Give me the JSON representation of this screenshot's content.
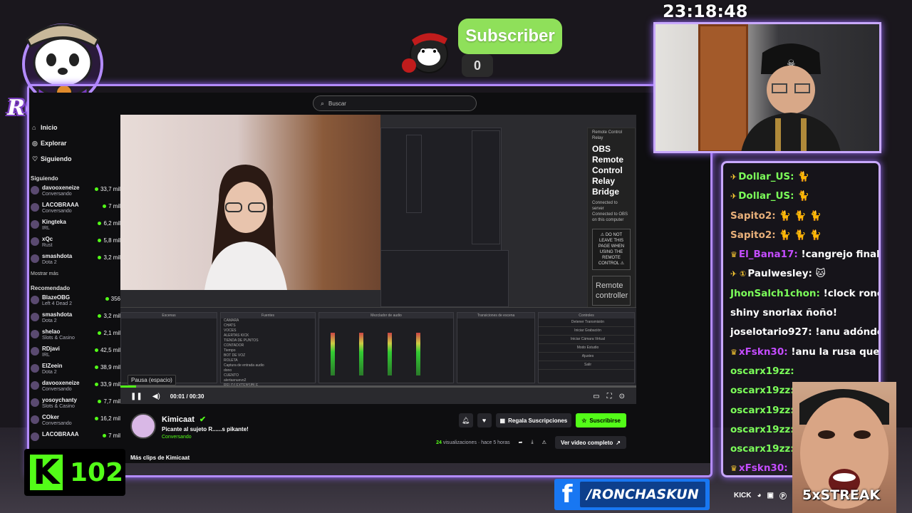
{
  "overlay": {
    "clock": "23:18:48",
    "subscriber_label": "Subscriber",
    "subscriber_count": "0",
    "logo_text": "RONCHAS",
    "kick_count": "102",
    "facebook_handle": "/RONCHASKUN",
    "social_icons": [
      "kick-icon",
      "discord-icon",
      "twitch-icon",
      "pinterest-icon"
    ],
    "social_kick_label": "KICK",
    "streak": "5xSTREAK",
    "accent_color": "#b48cff",
    "kick_green": "#53fc18"
  },
  "browser": {
    "search_placeholder": "Buscar",
    "nav": [
      {
        "label": "Inicio",
        "icon": "home-icon"
      },
      {
        "label": "Explorar",
        "icon": "compass-icon"
      },
      {
        "label": "Siguiendo",
        "icon": "heart-icon"
      }
    ],
    "following_title": "Siguiendo",
    "following": [
      {
        "name": "davooxeneize",
        "category": "Conversando",
        "viewers": "33,7 mil"
      },
      {
        "name": "LACOBRAAA",
        "category": "Conversando",
        "viewers": "7 mil"
      },
      {
        "name": "Kingteka",
        "category": "IRL",
        "viewers": "6,2 mil"
      },
      {
        "name": "xQc",
        "category": "Rust",
        "viewers": "5,8 mil"
      },
      {
        "name": "smashdota",
        "category": "Dota 2",
        "viewers": "3,2 mil"
      }
    ],
    "show_more": "Mostrar más",
    "recommended_title": "Recomendado",
    "recommended": [
      {
        "name": "BlazeOBG",
        "category": "Left 4 Dead 2",
        "viewers": "356"
      },
      {
        "name": "smashdota",
        "category": "Dota 2",
        "viewers": "3,2 mil"
      },
      {
        "name": "shelao",
        "category": "Slots & Casino",
        "viewers": "2,1 mil"
      },
      {
        "name": "RDjavi",
        "category": "IRL",
        "viewers": "42,5 mil"
      },
      {
        "name": "ElZeein",
        "category": "Dota 2",
        "viewers": "38,9 mil"
      },
      {
        "name": "davooxeneize",
        "category": "Conversando",
        "viewers": "33,9 mil"
      },
      {
        "name": "yosoychanty",
        "category": "Slots & Casino",
        "viewers": "7,7 mil"
      },
      {
        "name": "COker",
        "category": "Conversando",
        "viewers": "16,2 mil"
      },
      {
        "name": "LACOBRAAA",
        "category": "",
        "viewers": "7 mil"
      }
    ],
    "player": {
      "tooltip": "Pausa (espacio)",
      "time": "00:01 / 00:30",
      "progress": 0.03,
      "obs_title": "OBS Remote Control Relay Bridge",
      "obs_status": "Connected to server",
      "obs_status2": "Connected to OBS on this computer",
      "obs_warning": "⚠ DO NOT LEAVE THIS PAGE WHEN USING THE REMOTE CONTROL ⚠",
      "obs_button": "Remote controller",
      "obs_panel_header": "Remote Control Relay",
      "mixer_headers": [
        "Escenas",
        "Fuentes",
        "Mezclador de audio",
        "Transiciones de escena",
        "Controles"
      ],
      "sources": [
        "CAMARA",
        "CHATS",
        "VOCES",
        "ALERTAS KICK",
        "TIENDA DE PUNTOS",
        "CONTADOR",
        "Tiempo",
        "BOT DE VOZ",
        "ROLETA",
        "Captura de entrada audio",
        "dono",
        "CUENTO",
        "alertasnuevo2",
        "RELOJ EXTENSIBLE"
      ],
      "controls": [
        "Detener Transmisión",
        "Iniciar Grabación",
        "Iniciar Cámara Virtual",
        "Modo Estudio",
        "Ajustes",
        "Salir"
      ]
    },
    "clip": {
      "channel": "Kimicaat",
      "title": "Picante al sujeto R......s  pikante!",
      "category": "Conversando",
      "gift_label": "Regala Suscripciones",
      "subscribe_label": "Suscribirse",
      "views": "24",
      "views_label": "visualizaciones",
      "time_ago": "· hace 5 horas",
      "full_video": "Ver video completo",
      "more_clips": "Más clips de Kimicaat"
    }
  },
  "chat": [
    {
      "badges": "✈",
      "user": "Dollar_US:",
      "msg": "🐈",
      "color": "#7cff5a"
    },
    {
      "badges": "✈",
      "user": "Dollar_US:",
      "msg": "🐈",
      "color": "#7cff5a"
    },
    {
      "badges": "",
      "user": "Sapito2:",
      "msg": "🐈 🐈 🐈",
      "color": "#e8b07a"
    },
    {
      "badges": "",
      "user": "Sapito2:",
      "msg": "🐈 🐈 🐈",
      "color": "#e8b07a"
    },
    {
      "badges": "♛",
      "user": "El_Bana17:",
      "msg": "!cangrejo finalm",
      "color": "#c44cff"
    },
    {
      "badges": "✈ ①",
      "user": "Paulwesley:",
      "msg": "🐱",
      "color": "#ffffff"
    },
    {
      "badges": "",
      "user": "JhonSalch1chon:",
      "msg": "!clock ronch",
      "color": "#7cff5a"
    },
    {
      "badges": "",
      "user": "",
      "msg": "shiny snorlax ñoño!",
      "color": "#ffffff"
    },
    {
      "badges": "",
      "user": "joselotario927:",
      "msg": "!anu adónde va",
      "color": "#ffffff"
    },
    {
      "badges": "♛",
      "user": "xFskn30:",
      "msg": "!anu la rusa que",
      "color": "#c44cff"
    },
    {
      "badges": "",
      "user": "oscarx19zz:",
      "msg": "",
      "color": "#7cff5a"
    },
    {
      "badges": "",
      "user": "oscarx19zz:",
      "msg": "",
      "color": "#7cff5a"
    },
    {
      "badges": "",
      "user": "oscarx19zz:",
      "msg": "",
      "color": "#7cff5a"
    },
    {
      "badges": "",
      "user": "oscarx19zz:",
      "msg": "",
      "color": "#7cff5a"
    },
    {
      "badges": "",
      "user": "oscarx19zz:",
      "msg": "",
      "color": "#7cff5a"
    },
    {
      "badges": "♛",
      "user": "xFskn30:",
      "msg": "",
      "color": "#c44cff"
    }
  ]
}
